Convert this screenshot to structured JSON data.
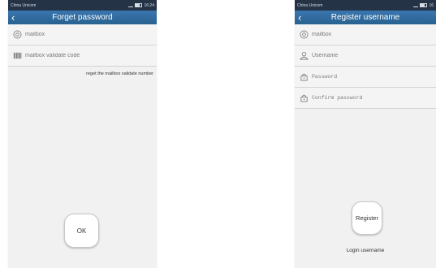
{
  "forget_screen": {
    "status": {
      "carrier": "China Unicom",
      "time": "16:24"
    },
    "title": "Forget password",
    "mailbox_placeholder": "mailbox",
    "validate_code_placeholder": "mailbox validate code",
    "get_code_link": "reget the mailbox validate number",
    "ok_label": "OK"
  },
  "register_screen": {
    "status": {
      "carrier": "China Unicom",
      "time": "16"
    },
    "title": "Register username",
    "mailbox_placeholder": "mailbox",
    "username_placeholder": "Username",
    "password_placeholder": "Password",
    "confirm_password_placeholder": "Confirm password",
    "register_label": "Register",
    "login_link": "Login username"
  },
  "colors": {
    "statusbar": "#243346",
    "titlebar": "#3a77b0",
    "background": "#f1f1f1"
  }
}
